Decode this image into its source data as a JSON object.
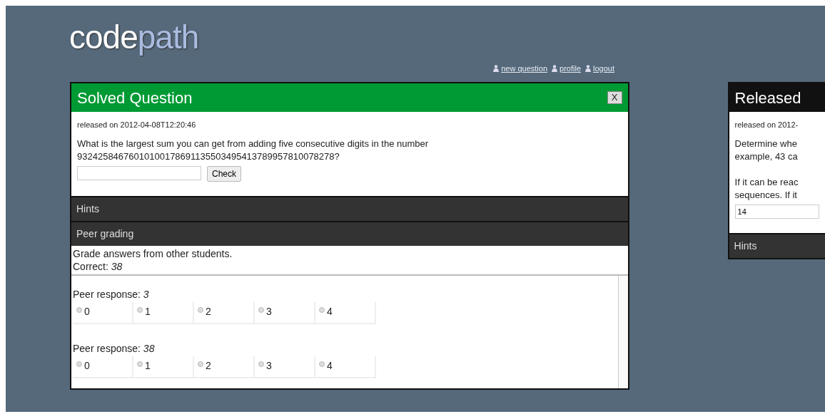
{
  "logo": {
    "part_1": "code",
    "part_2": "path"
  },
  "nav_links": [
    "new question",
    "profile",
    "logout"
  ],
  "panels": [
    {
      "title": "Solved Question",
      "kind": "solved",
      "close_label": "X",
      "released": "released on 2012-04-08T12:20:46",
      "question_paragraphs": [
        [
          "What is the largest sum you can get from adding five consecutive digits in the number",
          "93242584676010100178691135503495413789957810078278?"
        ]
      ],
      "answer": {
        "button": "Check"
      },
      "sections": [
        {
          "title": "Hints"
        },
        {
          "title": "Peer grading"
        }
      ],
      "peer_grading": {
        "intro": "Grade answers from other students.",
        "correct": "Correct: *38*",
        "responses": [
          {
            "label": "Peer response: *3*",
            "options": [
              {
                "label": "0",
                "selected": false
              },
              {
                "label": "1",
                "selected": false
              },
              {
                "label": "2",
                "selected": false
              },
              {
                "label": "3",
                "selected": false
              },
              {
                "label": "4",
                "selected": false
              }
            ]
          },
          {
            "label": "Peer response: *38*",
            "options": [
              {
                "label": "0",
                "selected": false
              },
              {
                "label": "1",
                "selected": false
              },
              {
                "label": "2",
                "selected": false
              },
              {
                "label": "3",
                "selected": false
              },
              {
                "label": "4",
                "selected": false
              }
            ]
          }
        ]
      }
    },
    {
      "title": "Released",
      "kind": "released",
      "released": "released on 2012-",
      "question_paragraphs": [
        [
          "Determine whe",
          "example, 43 ca"
        ],
        [
          "If it can be reac",
          "sequences. If it"
        ]
      ],
      "answer": {
        "value": "14"
      },
      "sections": [
        {
          "title": "Hints"
        }
      ]
    }
  ]
}
